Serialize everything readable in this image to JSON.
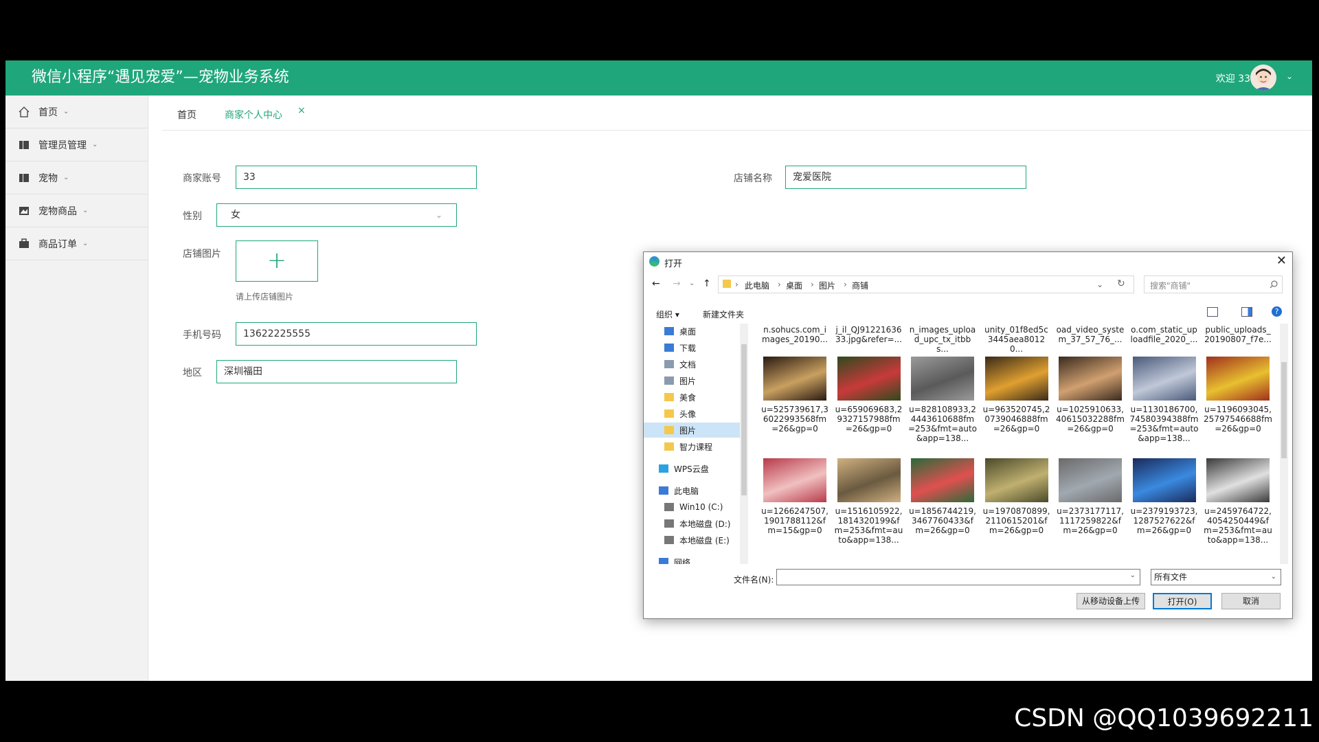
{
  "app": {
    "title": "微信小程序“遇见宠爱”—宠物业务系统",
    "welcome": "欢迎 33",
    "brand_color": "#1fa67a"
  },
  "sidebar": {
    "items": [
      {
        "label": "首页",
        "icon": "home-icon"
      },
      {
        "label": "管理员管理",
        "icon": "admin-icon"
      },
      {
        "label": "宠物",
        "icon": "pet-icon"
      },
      {
        "label": "宠物商品",
        "icon": "goods-icon"
      },
      {
        "label": "商品订单",
        "icon": "order-icon"
      }
    ]
  },
  "tabs": [
    {
      "label": "首页",
      "active": false
    },
    {
      "label": "商家个人中心",
      "active": true,
      "close": "×"
    }
  ],
  "form": {
    "account_label": "商家账号",
    "account_value": "33",
    "shop_label": "店铺名称",
    "shop_value": "宠爱医院",
    "gender_label": "性别",
    "gender_value": "女",
    "image_label": "店铺图片",
    "upload_plus": "+",
    "upload_hint": "请上传店铺图片",
    "phone_label": "手机号码",
    "phone_value": "13622225555",
    "region_label": "地区",
    "region_value": "深圳福田"
  },
  "dialog": {
    "title": "打开",
    "close": "✕",
    "breadcrumbs": [
      "此电脑",
      "桌面",
      "图片",
      "商铺"
    ],
    "search_placeholder": "搜索\"商铺\"",
    "organize": "组织 ▾",
    "new_folder": "新建文件夹",
    "nav": [
      {
        "label": "桌面",
        "kind": "desktop"
      },
      {
        "label": "下载",
        "kind": "download"
      },
      {
        "label": "文档",
        "kind": "doc"
      },
      {
        "label": "图片",
        "kind": "pic"
      },
      {
        "label": "美食",
        "kind": "folder"
      },
      {
        "label": "头像",
        "kind": "folder"
      },
      {
        "label": "图片",
        "kind": "folder",
        "selected": true
      },
      {
        "label": "智力课程",
        "kind": "folder"
      },
      {
        "label": "WPS云盘",
        "kind": "cloud"
      },
      {
        "label": "此电脑",
        "kind": "pc"
      },
      {
        "label": "Win10 (C:)",
        "kind": "drive"
      },
      {
        "label": "本地磁盘 (D:)",
        "kind": "drive"
      },
      {
        "label": "本地磁盘 (E:)",
        "kind": "drive"
      },
      {
        "label": "网络",
        "kind": "net"
      }
    ],
    "files_top": [
      "n.sohucs.com_images_20190...",
      "j_il_QJ9122163633.jpg&refer=...",
      "n_images_upload_upc_tx_itbbs...",
      "unity_01f8ed5c3445aea80120...",
      "oad_video_system_37_57_76_...",
      "o.com_static_uploadfile_2020_...",
      "public_uploads_20190807_f7e..."
    ],
    "files_row1": [
      "u=525739617,36022993568fm=26&gp=0",
      "u=659069683,29327157988fm=26&gp=0",
      "u=828108933,24443610688fm=253&fmt=auto&app=138...",
      "u=963520745,20739046888fm=26&gp=0",
      "u=1025910633,40615032288fm=26&gp=0",
      "u=1130186700,74580394388fm=253&fmt=auto&app=138...",
      "u=1196093045,25797546688fm=26&gp=0"
    ],
    "files_row2": [
      "u=1266247507,1901788112&fm=15&gp=0",
      "u=1516105922,1814320199&fm=253&fmt=auto&app=138...",
      "u=1856744219,3467760433&fm=26&gp=0",
      "u=1970870899,2110615201&fm=26&gp=0",
      "u=2373177117,1117259822&fm=26&gp=0",
      "u=2379193723,1287527622&fm=26&gp=0",
      "u=2459764722,4054250449&fm=253&fmt=auto&app=138..."
    ],
    "filename_label": "文件名(N):",
    "filetype": "所有文件",
    "btn_mobile": "从移动设备上传",
    "btn_open": "打开(O)",
    "btn_cancel": "取消"
  },
  "watermark": "CSDN @QQ1039692211"
}
